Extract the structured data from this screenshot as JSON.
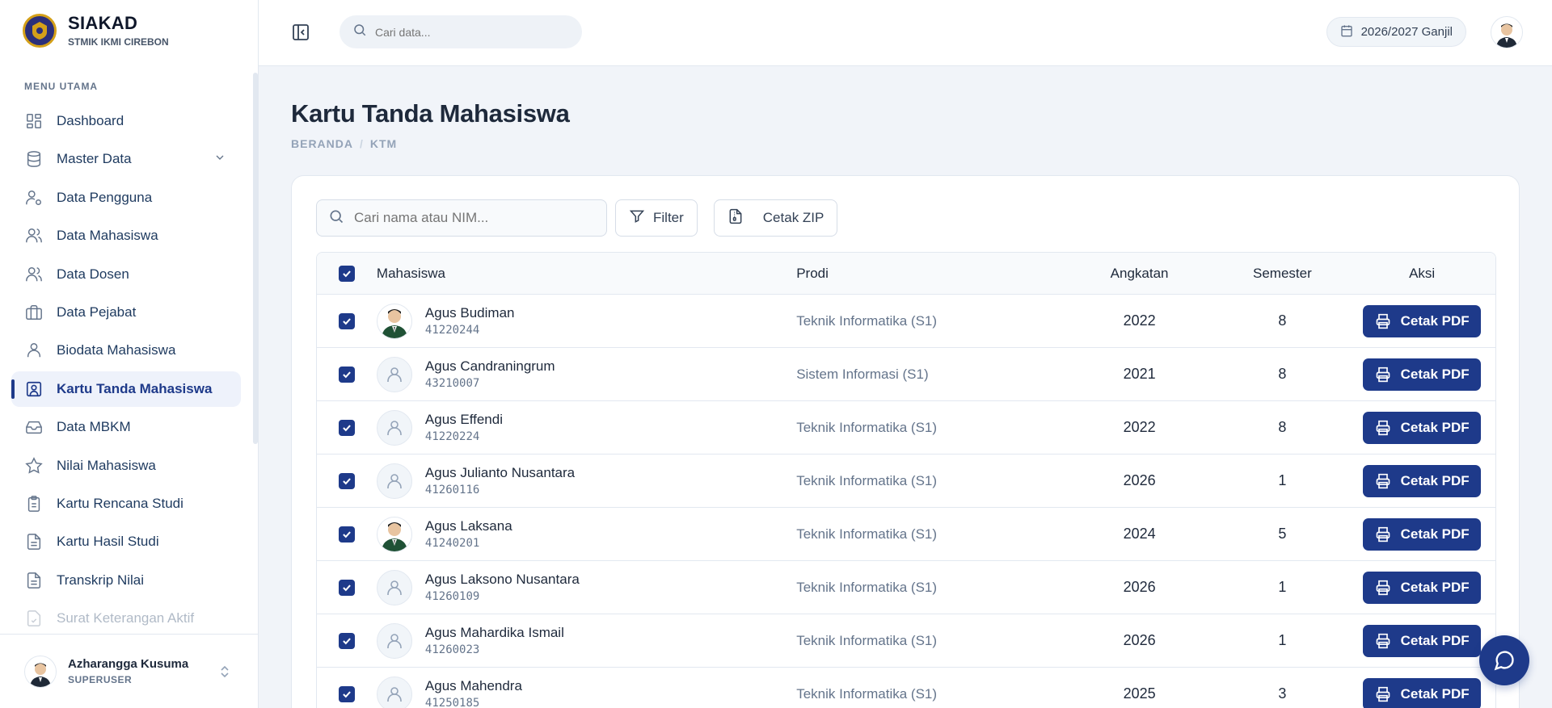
{
  "app": {
    "name": "SIAKAD",
    "institution": "STMIK IKMI CIREBON"
  },
  "sidebar": {
    "section_title": "MENU UTAMA",
    "items": [
      {
        "label": "Dashboard",
        "icon": "grid-icon"
      },
      {
        "label": "Master Data",
        "icon": "database-icon"
      },
      {
        "label": "Data Pengguna",
        "icon": "user-cog-icon"
      },
      {
        "label": "Data Mahasiswa",
        "icon": "users-icon"
      },
      {
        "label": "Data Dosen",
        "icon": "users-icon"
      },
      {
        "label": "Data Pejabat",
        "icon": "briefcase-icon"
      },
      {
        "label": "Biodata Mahasiswa",
        "icon": "user-icon"
      },
      {
        "label": "Kartu Tanda Mahasiswa",
        "icon": "id-card-icon"
      },
      {
        "label": "Data MBKM",
        "icon": "inbox-icon"
      },
      {
        "label": "Nilai Mahasiswa",
        "icon": "star-icon"
      },
      {
        "label": "Kartu Rencana Studi",
        "icon": "clipboard-icon"
      },
      {
        "label": "Kartu Hasil Studi",
        "icon": "file-text-icon"
      },
      {
        "label": "Transkrip Nilai",
        "icon": "file-text-icon"
      },
      {
        "label": "Surat Keterangan Aktif",
        "icon": "file-check-icon"
      }
    ],
    "active_item": "Kartu Tanda Mahasiswa",
    "user": {
      "name": "Azharangga Kusuma",
      "role": "SUPERUSER"
    }
  },
  "topbar": {
    "search_placeholder": "Cari data...",
    "period": "2026/2027 Ganjil"
  },
  "page": {
    "title": "Kartu Tanda Mahasiswa",
    "breadcrumb": [
      "BERANDA",
      "KTM"
    ]
  },
  "toolbar": {
    "search_placeholder": "Cari nama atau NIM...",
    "filter_label": "Filter",
    "zip_label": "Cetak ZIP"
  },
  "table": {
    "headers": {
      "student": "Mahasiswa",
      "program": "Prodi",
      "year": "Angkatan",
      "semester": "Semester",
      "action": "Aksi"
    },
    "action_label": "Cetak PDF",
    "rows": [
      {
        "name": "Agus Budiman",
        "nim": "41220244",
        "prodi": "Teknik Informatika (S1)",
        "angkatan": "2022",
        "semester": "8",
        "photo": true
      },
      {
        "name": "Agus Candraningrum",
        "nim": "43210007",
        "prodi": "Sistem Informasi (S1)",
        "angkatan": "2021",
        "semester": "8",
        "photo": false
      },
      {
        "name": "Agus Effendi",
        "nim": "41220224",
        "prodi": "Teknik Informatika (S1)",
        "angkatan": "2022",
        "semester": "8",
        "photo": false
      },
      {
        "name": "Agus Julianto Nusantara",
        "nim": "41260116",
        "prodi": "Teknik Informatika (S1)",
        "angkatan": "2026",
        "semester": "1",
        "photo": false
      },
      {
        "name": "Agus Laksana",
        "nim": "41240201",
        "prodi": "Teknik Informatika (S1)",
        "angkatan": "2024",
        "semester": "5",
        "photo": true
      },
      {
        "name": "Agus Laksono Nusantara",
        "nim": "41260109",
        "prodi": "Teknik Informatika (S1)",
        "angkatan": "2026",
        "semester": "1",
        "photo": false
      },
      {
        "name": "Agus Mahardika Ismail",
        "nim": "41260023",
        "prodi": "Teknik Informatika (S1)",
        "angkatan": "2026",
        "semester": "1",
        "photo": false
      },
      {
        "name": "Agus Mahendra",
        "nim": "41250185",
        "prodi": "Teknik Informatika (S1)",
        "angkatan": "2025",
        "semester": "3",
        "photo": false
      }
    ]
  },
  "colors": {
    "primary": "#1e3a8a",
    "background": "#f1f4f9"
  }
}
